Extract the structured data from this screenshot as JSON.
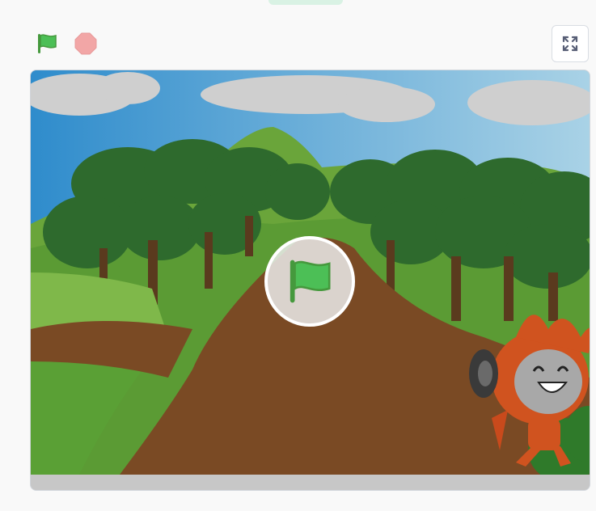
{
  "controls": {
    "green_flag_icon": "green-flag-icon",
    "stop_icon": "stop-sign-icon",
    "fullscreen_icon": "fullscreen-icon"
  },
  "colors": {
    "flag_green": "#4cbf56",
    "stop_red": "#f2a6a6",
    "sky_blue": "#5aa9d6",
    "path_brown": "#7a4a24",
    "grass_green": "#5fa83a",
    "tree_dark": "#2f6e2e"
  },
  "stage": {
    "start_overlay_icon": "green-flag-icon",
    "backdrop": "forest-path",
    "sprite": "fire-character"
  }
}
